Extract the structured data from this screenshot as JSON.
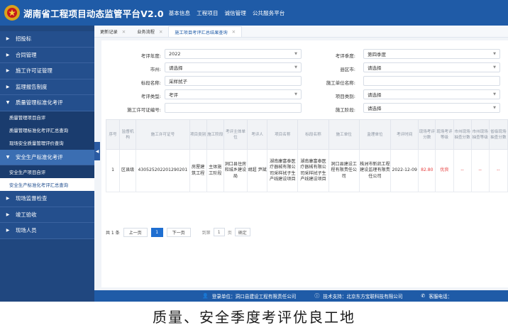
{
  "header": {
    "title": "湖南省工程项目动态监管平台V2.0",
    "nav": [
      "基本信息",
      "工程项目",
      "诚信管理",
      "公共服务平台"
    ]
  },
  "sidebar": {
    "items": [
      {
        "label": "招投标"
      },
      {
        "label": "合同管理"
      },
      {
        "label": "施工许可证管理"
      },
      {
        "label": "监理报告制度"
      },
      {
        "label": "质量管理标准化考评"
      },
      {
        "label": "质量管理项目自评"
      },
      {
        "label": "质量管理标准化考评汇总查询"
      },
      {
        "label": "现场安全质量管理评价查询"
      },
      {
        "label": "安全生产标准化考评"
      },
      {
        "label": "安全生产项目自评"
      },
      {
        "label": "安全生产标准化考评汇总查询"
      },
      {
        "label": "现场监督检查"
      },
      {
        "label": "竣工验收"
      },
      {
        "label": "现场人员"
      }
    ]
  },
  "tabs": [
    {
      "label": "更新记录"
    },
    {
      "label": "业务流程"
    },
    {
      "label": "施工项目考评汇总结果查询"
    }
  ],
  "filters": {
    "year_label": "考评年度:",
    "year_value": "2022",
    "season_label": "考评季度:",
    "season_value": "第四季度",
    "city_label": "市州:",
    "city_value": "请选择",
    "county_label": "县区市:",
    "county_value": "请选择",
    "section_label": "标段名称:",
    "section_value": "采样拭子",
    "unit_label": "施工单位名称:",
    "unit_value": "",
    "type_label": "考评类型:",
    "type_value": "考评",
    "category_label": "项目类别:",
    "category_value": "请选择",
    "permit_label": "施工许可证编号:",
    "permit_value": "",
    "phase_label": "施工阶段:",
    "phase_value": "请选择"
  },
  "table": {
    "headers": [
      "序号",
      "监督机构",
      "施工许可证号",
      "项目类别",
      "施工阶段",
      "考评主体单位",
      "考评人",
      "项目名称",
      "标段名称",
      "施工单位",
      "监理单位",
      "考评时间",
      "现场考评分数",
      "现场考评等级",
      "市州现场抽查分数",
      "市州现场抽查等级",
      "省级现场抽查分数"
    ],
    "rows": [
      [
        "1",
        "区县级",
        "430525202201290201",
        "房屋建筑工程",
        "主体施工阶段",
        "洞口县住房和城乡建设局",
        "胡超 尹斌",
        "湖南康富泰医疗器械有限公司采样拭子生产线建设项目",
        "湖南康富泰医疗器械有限公司采样拭子生产线建设项目",
        "洞口县建设工程有限责任公司",
        "株洲市新凯工程建设监理有限责任公司",
        "2022-12-09",
        "82.80",
        "优良",
        "--",
        "--",
        "--"
      ]
    ]
  },
  "pager": {
    "total": "共 1 条",
    "prev": "上一页",
    "page": "1",
    "next": "下一页",
    "goto_label": "到第",
    "goto_value": "1",
    "page_unit": "页",
    "confirm": "确定"
  },
  "footer": {
    "login": "登录单位：洞口县建设工程有限责任公司",
    "support": "技术支持：北京东方宝联科技有限公司",
    "hotline": "客服电话："
  },
  "caption": "质量、安全季度考评优良工地",
  "colors": {
    "header_blue": "#1f5ba7",
    "sidebar_blue": "#20477f",
    "accent_red": "#e53b3b"
  }
}
